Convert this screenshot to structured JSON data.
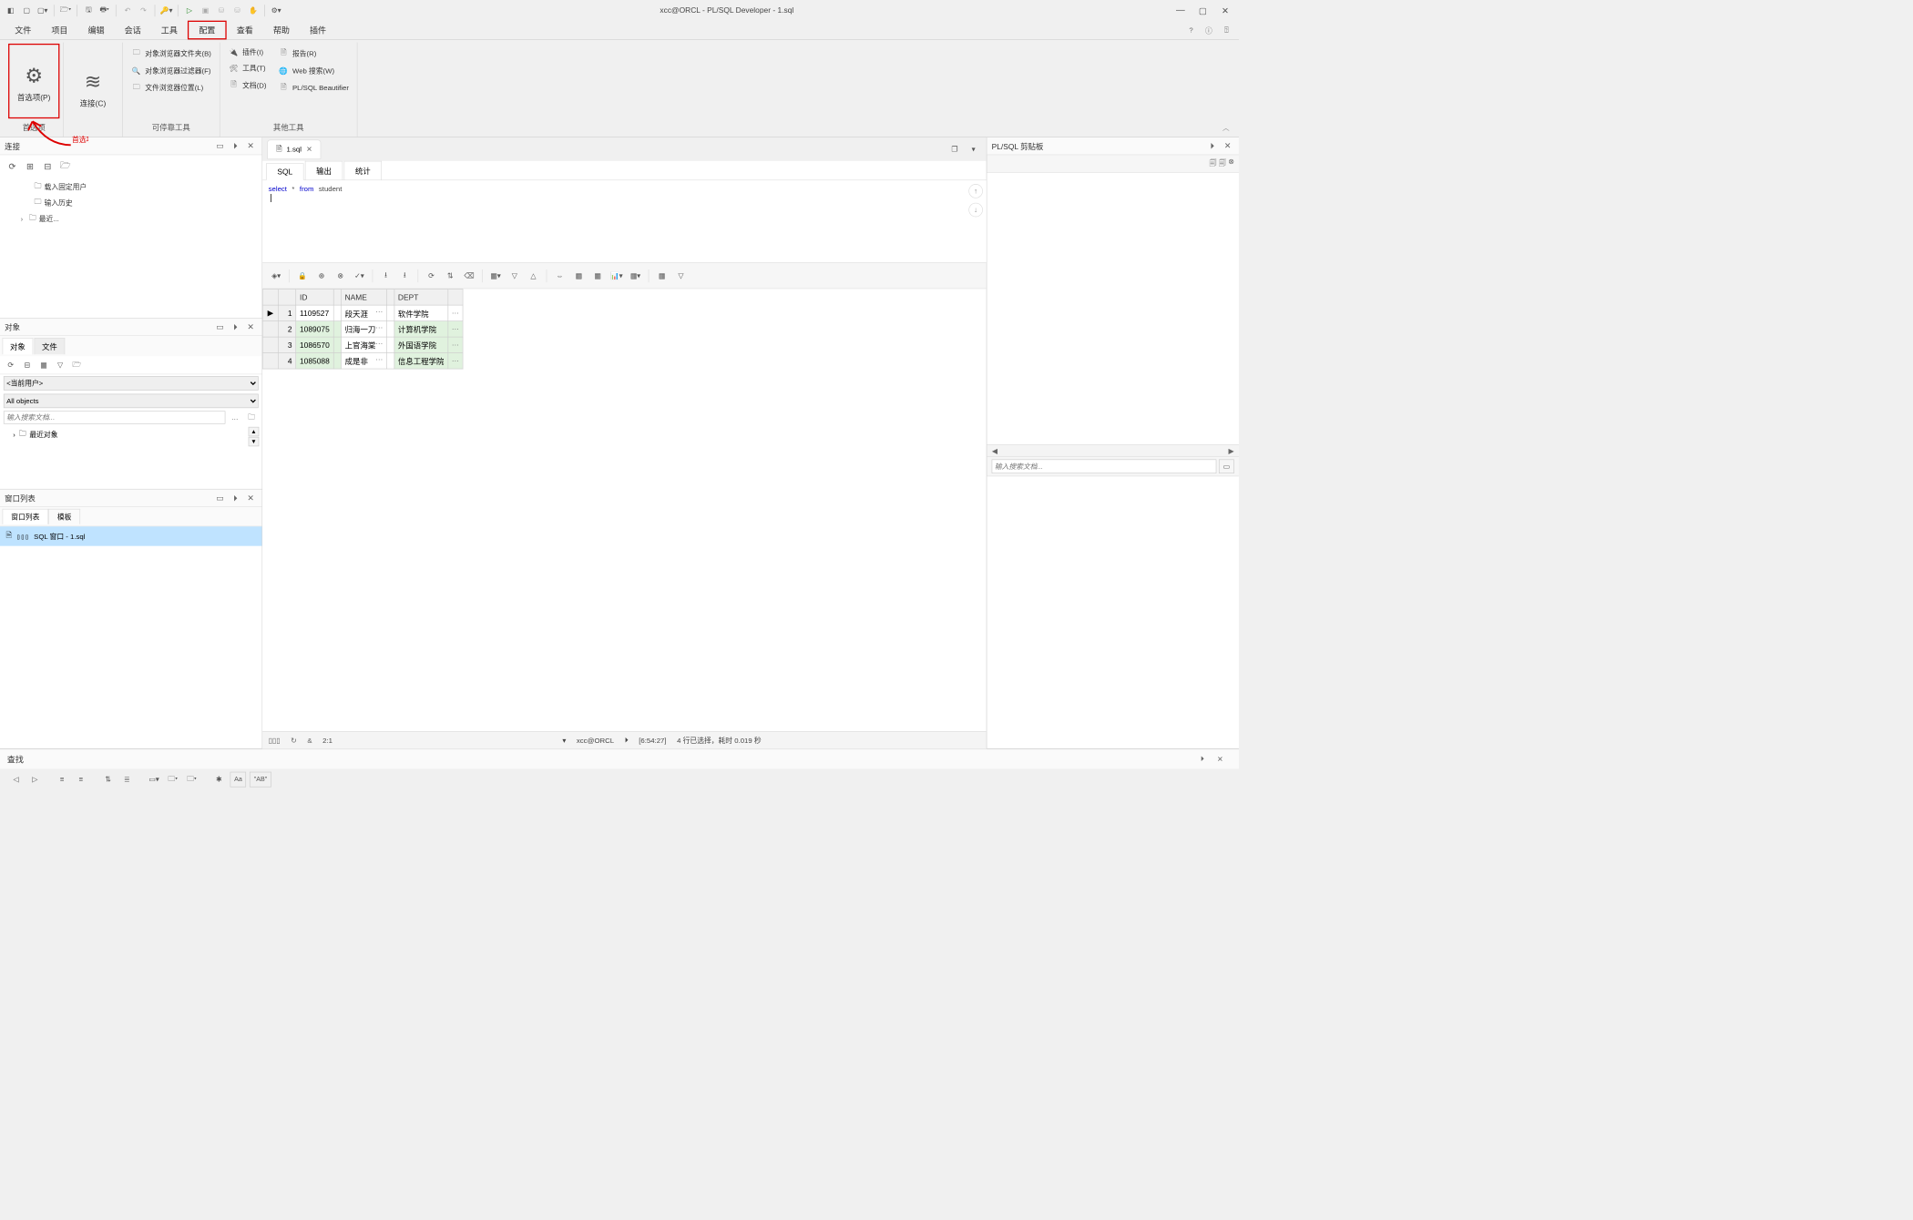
{
  "title": "xcc@ORCL - PL/SQL Developer - 1.sql",
  "menubar": [
    "文件",
    "项目",
    "编辑",
    "会话",
    "工具",
    "配置",
    "查看",
    "帮助",
    "插件"
  ],
  "menubar_highlight_index": 5,
  "ribbon": {
    "group_labels": [
      "首选项",
      "",
      "可停靠工具",
      "其他工具"
    ],
    "prefs_btn": "首选项(P)",
    "connect_btn": "连接(C)",
    "dock_small": [
      "对象浏览器文件夹(B)",
      "对象浏览器过滤器(F)",
      "文件浏览器位置(L)"
    ],
    "other_left": [
      "插件(I)",
      "工具(T)",
      "文档(D)"
    ],
    "other_right": [
      "报告(R)",
      "Web 搜索(W)",
      "PL/SQL Beautifier"
    ]
  },
  "annotation_label": "首选项",
  "panels": {
    "connection": {
      "title": "连接",
      "tree": [
        "载入固定用户",
        "输入历史",
        "最近..."
      ]
    },
    "objects": {
      "title": "对象",
      "tabs": [
        "对象",
        "文件"
      ],
      "user_dropdown": "<当前用户>",
      "filter_dropdown": "All objects",
      "search_placeholder": "输入搜索文档...",
      "items": [
        "最近对象"
      ]
    },
    "window_list": {
      "title": "窗口列表",
      "tabs": [
        "窗口列表",
        "模板"
      ],
      "item": "SQL 窗口 - 1.sql"
    },
    "clipboard": {
      "title": "PL/SQL 剪贴板",
      "search_placeholder": "输入搜索文档..."
    }
  },
  "doc_tab": "1.sql",
  "sub_tabs": [
    "SQL",
    "输出",
    "统计"
  ],
  "sql_tokens": {
    "select": "select",
    "star": "*",
    "from": "from",
    "table": "student"
  },
  "grid": {
    "cols": [
      "ID",
      "NAME",
      "DEPT"
    ],
    "rows": [
      {
        "n": 1,
        "id": "1109527",
        "name": "段天涯",
        "dept": "软件学院",
        "marker": "▶"
      },
      {
        "n": 2,
        "id": "1089075",
        "name": "归海一刀",
        "dept": "计算机学院",
        "marker": ""
      },
      {
        "n": 3,
        "id": "1086570",
        "name": "上官海棠",
        "dept": "外国语学院",
        "marker": ""
      },
      {
        "n": 4,
        "id": "1085088",
        "name": "成是非",
        "dept": "信息工程学院",
        "marker": ""
      }
    ]
  },
  "statusbar": {
    "pos": "2:1",
    "conn": "xcc@ORCL",
    "time": "[6:54:27]",
    "msg": "4 行已选择，耗时 0.019 秒"
  },
  "findbar_label": "查找"
}
